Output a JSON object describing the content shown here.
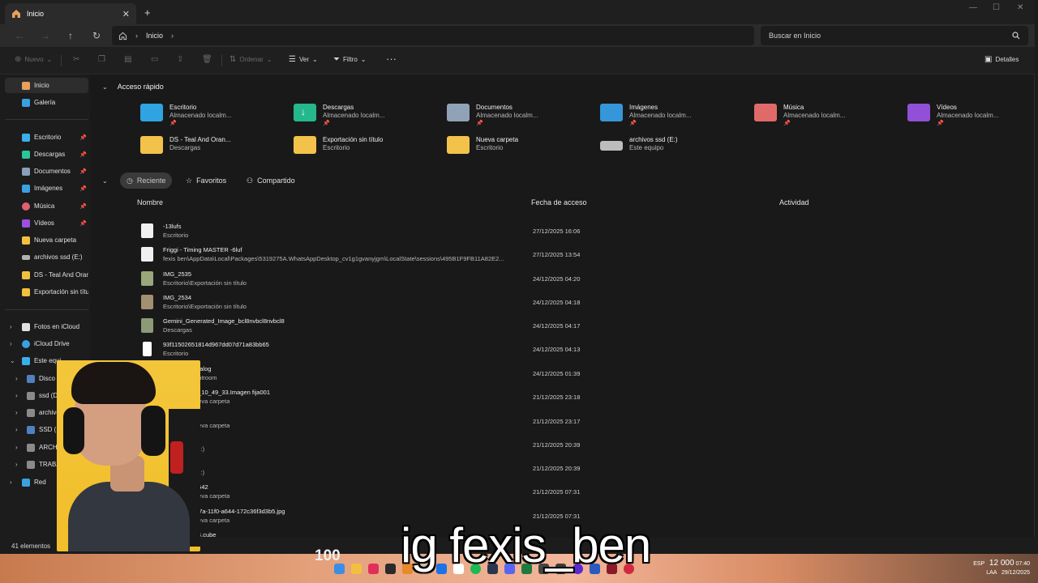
{
  "window": {
    "tab_label": "Inicio",
    "new_tab": "+"
  },
  "nav": {
    "breadcrumb": "Inicio",
    "search_placeholder": "Buscar en Inicio"
  },
  "cmdbar": {
    "new_label": "Nuevo",
    "sort_label": "Ordenar",
    "view_label": "Ver",
    "filter_label": "Filtro",
    "more_label": "···",
    "details_label": "Detalles"
  },
  "sidebar": {
    "items": [
      {
        "label": "Inicio",
        "color": "#e8a060",
        "active": true
      },
      {
        "label": "Galería",
        "color": "#3aa0e0"
      },
      {
        "label": "Escritorio",
        "color": "#3ab0e8",
        "pinned": true
      },
      {
        "label": "Descargas",
        "color": "#2cc49a",
        "pinned": true
      },
      {
        "label": "Documentos",
        "color": "#8aa0b8",
        "pinned": true
      },
      {
        "label": "Imágenes",
        "color": "#3aa0e0",
        "pinned": true
      },
      {
        "label": "Música",
        "color": "#e06070",
        "pinned": true
      },
      {
        "label": "Vídeos",
        "color": "#9a50e0",
        "pinned": true
      },
      {
        "label": "Nueva carpeta",
        "color": "#f2c040"
      },
      {
        "label": "archivos ssd (E:)",
        "color": "#b0b0b0"
      },
      {
        "label": "DS - Teal And Oran",
        "color": "#f2c040"
      },
      {
        "label": "Exportación sin títu",
        "color": "#f2c040"
      },
      {
        "label": "Fotos en iCloud",
        "color": "#e0e0e0"
      },
      {
        "label": "iCloud Drive",
        "color": "#3aa0e0"
      },
      {
        "label": "Este equi",
        "color": "#3ab0e8"
      },
      {
        "label": "Disco l",
        "color": "#5080c0"
      },
      {
        "label": "ssd (D:",
        "color": "#8a8a8a"
      },
      {
        "label": "archivo",
        "color": "#8a8a8a"
      },
      {
        "label": "SSD (F",
        "color": "#5080c0"
      },
      {
        "label": "ARCHI",
        "color": "#8a8a8a"
      },
      {
        "label": "TRABA",
        "color": "#8a8a8a"
      },
      {
        "label": "Red",
        "color": "#3aa0e0"
      }
    ]
  },
  "quick_access": {
    "title": "Acceso rápido",
    "items": [
      {
        "name": "Escritorio",
        "sub": "Almacenado localm...",
        "color": "#2fa4e0",
        "pinned": true
      },
      {
        "name": "Descargas",
        "sub": "Almacenado localm...",
        "color": "#25b88c",
        "pinned": true
      },
      {
        "name": "Documentos",
        "sub": "Almacenado localm...",
        "color": "#8fa2b6",
        "pinned": true
      },
      {
        "name": "Imágenes",
        "sub": "Almacenado localm...",
        "color": "#3596da",
        "pinned": true
      },
      {
        "name": "Música",
        "sub": "Almacenado localm...",
        "color": "#e06a6a",
        "pinned": true
      },
      {
        "name": "Vídeos",
        "sub": "Almacenado localm...",
        "color": "#9250d8",
        "pinned": true
      },
      {
        "name": "DS - Teal And Oran...",
        "sub": "Descargas",
        "color": "#f2c24a"
      },
      {
        "name": "Exportación sin título",
        "sub": "Escritorio",
        "color": "#f2c24a"
      },
      {
        "name": "Nueva carpeta",
        "sub": "Escritorio",
        "color": "#f2c24a"
      },
      {
        "name": "archivos ssd (E:)",
        "sub": "Este equipo",
        "color": "#bdbdbd"
      }
    ]
  },
  "filters": [
    {
      "label": "Reciente",
      "active": true
    },
    {
      "label": "Favoritos"
    },
    {
      "label": "Compartido"
    }
  ],
  "columns": {
    "name": "Nombre",
    "date": "Fecha de acceso",
    "activity": "Actividad"
  },
  "files": [
    {
      "name": "-13lufs",
      "path": "Escritorio",
      "date": "27/12/2025 16:06",
      "icon_color": "#f0f0f0"
    },
    {
      "name": "Friggi - Timing MASTER -6luf",
      "path": "fexis ben\\AppData\\Local\\Packages\\5319275A.WhatsAppDesktop_cv1g1gvanyjgm\\LocalState\\sessions\\495B1F9FB11A82E2...",
      "date": "27/12/2025 13:54",
      "icon_color": "#f0f0f0"
    },
    {
      "name": "IMG_2535",
      "path": "Escritorio\\Exportación sin título",
      "date": "24/12/2025 04:20",
      "icon_color": "#9aa77a"
    },
    {
      "name": "IMG_2534",
      "path": "Escritorio\\Exportación sin título",
      "date": "24/12/2025 04:18",
      "icon_color": "#a39070"
    },
    {
      "name": "Gemini_Generated_Image_bcl8nvbcl8nvbcl8",
      "path": "Descargas",
      "date": "24/12/2025 04:17",
      "icon_color": "#8c9a78"
    },
    {
      "name": "93f11502651814d967dd07d71a83bb65",
      "path": "Escritorio",
      "date": "24/12/2025 04:13",
      "icon_color": "#ffffff"
    },
    {
      "name": "atalog",
      "path": "ghtroom",
      "date": "24/12/2025 01:39",
      "icon_color": "#404040"
    },
    {
      "name": "0_10_49_33.Imagen fija001",
      "path": "ueva carpeta",
      "date": "21/12/2025 23:18",
      "icon_color": "#404040"
    },
    {
      "name": "",
      "path": "ueva carpeta",
      "date": "21/12/2025 23:17",
      "icon_color": "#404040"
    },
    {
      "name": "",
      "path": "(E:)",
      "date": "21/12/2025 20:39",
      "icon_color": "#404040"
    },
    {
      "name": "",
      "path": "(E:)",
      "date": "21/12/2025 20:39",
      "icon_color": "#404040"
    },
    {
      "name": "0542",
      "path": "ueva carpeta",
      "date": "21/12/2025 07:31",
      "icon_color": "#404040"
    },
    {
      "name": "ad695e20-d?7a-11f0-a644-172c36f3d3b5.jpg",
      "path": "Escritorio\\Nueva carpeta",
      "date": "21/12/2025 07:31",
      "icon_color": "#b79aa8"
    },
    {
      "name": "Teal Orange 4.cube",
      "path": "",
      "date": "",
      "icon_color": "#e8e8e8"
    }
  ],
  "status": {
    "count": "41 elementos"
  },
  "taskbar": {
    "hud_text": "100",
    "lang": "ESP",
    "lang2": "LAA",
    "time": "07:40",
    "date": "29/12/2025",
    "money": "12 000"
  },
  "caption": "ig fexis_ben"
}
